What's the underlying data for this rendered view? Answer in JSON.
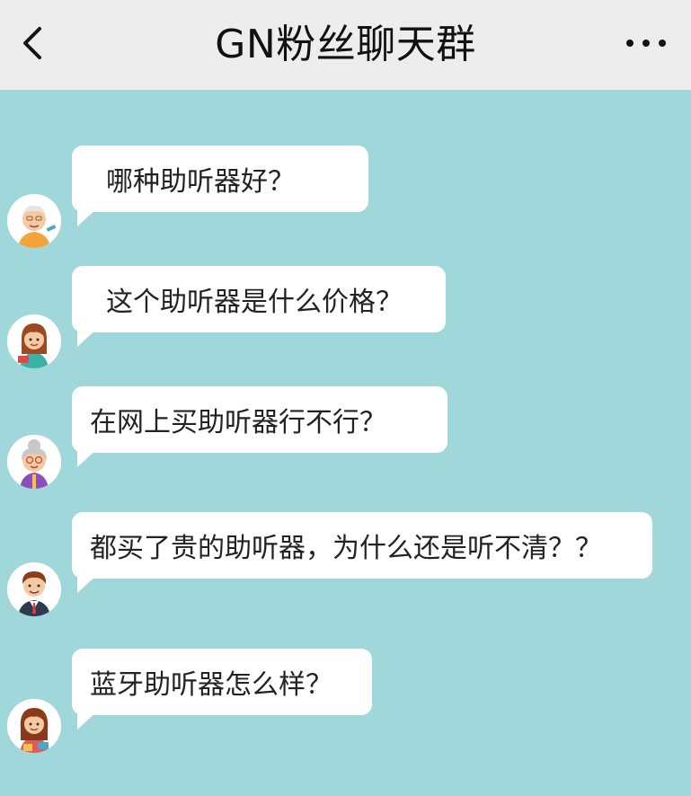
{
  "header": {
    "title": "GN粉丝聊天群",
    "back_icon": "chevron-left-icon",
    "more_icon": "more-horizontal-icon"
  },
  "colors": {
    "header_bg": "#ededed",
    "chat_bg": "#9fd7da",
    "bubble_bg": "#ffffff"
  },
  "messages": [
    {
      "avatar": "old-man-avatar",
      "text": "哪种助听器好？"
    },
    {
      "avatar": "woman-avatar",
      "text": "这个助听器是什么价格？"
    },
    {
      "avatar": "grandma-avatar",
      "text": "在网上买助听器行不行？"
    },
    {
      "avatar": "businessman-avatar",
      "text": "都买了贵的助听器，为什么还是听不清？？"
    },
    {
      "avatar": "girl-avatar",
      "text": "蓝牙助听器怎么样？"
    }
  ]
}
